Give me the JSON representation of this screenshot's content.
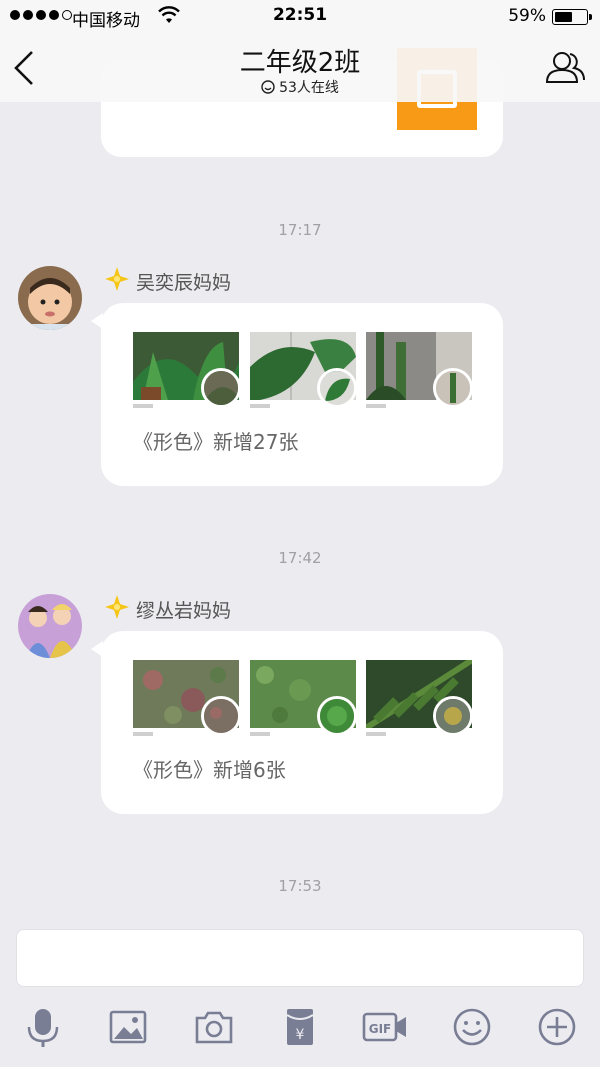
{
  "status_bar": {
    "carrier": "中国移动",
    "time": "22:51",
    "battery": "59%",
    "battery_level": 0.59
  },
  "nav": {
    "title": "二年级2班",
    "online": "53人在线"
  },
  "messages": [
    {
      "time": "17:17",
      "sender": "吴奕辰妈妈",
      "album_text": "《形色》新增27张"
    },
    {
      "time": "17:42",
      "sender": "缪丛岩妈妈",
      "album_text": "《形色》新增6张"
    }
  ],
  "footer_time": "17:53",
  "toolbar": {
    "icons": [
      "microphone-icon",
      "image-icon",
      "camera-icon",
      "red-packet-icon",
      "gif-icon",
      "emoji-icon",
      "plus-icon"
    ]
  },
  "colors": {
    "background": "#ebebf0",
    "accent_orange": "#f89a16",
    "badge_yellow": "#f5c518"
  }
}
